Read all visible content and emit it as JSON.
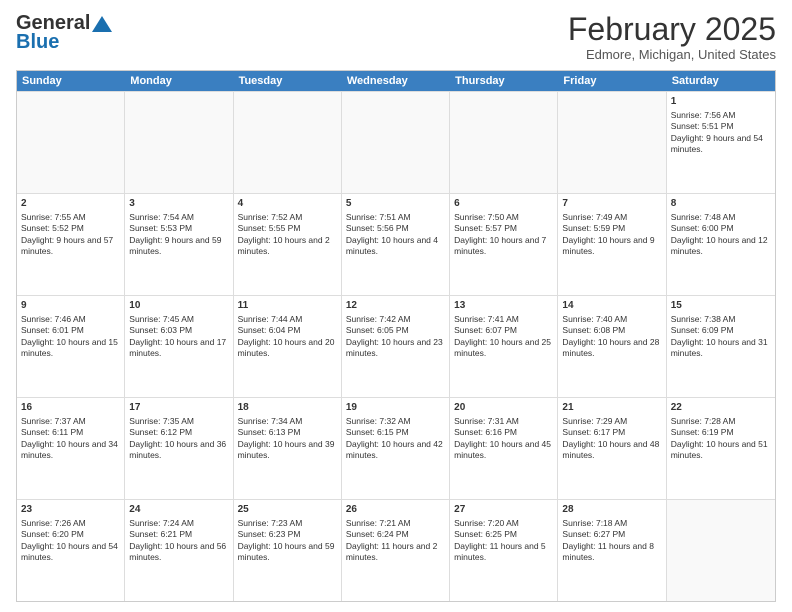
{
  "header": {
    "logo_general": "General",
    "logo_blue": "Blue",
    "month_title": "February 2025",
    "location": "Edmore, Michigan, United States"
  },
  "calendar": {
    "days_of_week": [
      "Sunday",
      "Monday",
      "Tuesday",
      "Wednesday",
      "Thursday",
      "Friday",
      "Saturday"
    ],
    "weeks": [
      [
        {
          "day": "",
          "empty": true
        },
        {
          "day": "",
          "empty": true
        },
        {
          "day": "",
          "empty": true
        },
        {
          "day": "",
          "empty": true
        },
        {
          "day": "",
          "empty": true
        },
        {
          "day": "",
          "empty": true
        },
        {
          "day": "1",
          "info": "Sunrise: 7:56 AM\nSunset: 5:51 PM\nDaylight: 9 hours and 54 minutes."
        }
      ],
      [
        {
          "day": "2",
          "info": "Sunrise: 7:55 AM\nSunset: 5:52 PM\nDaylight: 9 hours and 57 minutes."
        },
        {
          "day": "3",
          "info": "Sunrise: 7:54 AM\nSunset: 5:53 PM\nDaylight: 9 hours and 59 minutes."
        },
        {
          "day": "4",
          "info": "Sunrise: 7:52 AM\nSunset: 5:55 PM\nDaylight: 10 hours and 2 minutes."
        },
        {
          "day": "5",
          "info": "Sunrise: 7:51 AM\nSunset: 5:56 PM\nDaylight: 10 hours and 4 minutes."
        },
        {
          "day": "6",
          "info": "Sunrise: 7:50 AM\nSunset: 5:57 PM\nDaylight: 10 hours and 7 minutes."
        },
        {
          "day": "7",
          "info": "Sunrise: 7:49 AM\nSunset: 5:59 PM\nDaylight: 10 hours and 9 minutes."
        },
        {
          "day": "8",
          "info": "Sunrise: 7:48 AM\nSunset: 6:00 PM\nDaylight: 10 hours and 12 minutes."
        }
      ],
      [
        {
          "day": "9",
          "info": "Sunrise: 7:46 AM\nSunset: 6:01 PM\nDaylight: 10 hours and 15 minutes."
        },
        {
          "day": "10",
          "info": "Sunrise: 7:45 AM\nSunset: 6:03 PM\nDaylight: 10 hours and 17 minutes."
        },
        {
          "day": "11",
          "info": "Sunrise: 7:44 AM\nSunset: 6:04 PM\nDaylight: 10 hours and 20 minutes."
        },
        {
          "day": "12",
          "info": "Sunrise: 7:42 AM\nSunset: 6:05 PM\nDaylight: 10 hours and 23 minutes."
        },
        {
          "day": "13",
          "info": "Sunrise: 7:41 AM\nSunset: 6:07 PM\nDaylight: 10 hours and 25 minutes."
        },
        {
          "day": "14",
          "info": "Sunrise: 7:40 AM\nSunset: 6:08 PM\nDaylight: 10 hours and 28 minutes."
        },
        {
          "day": "15",
          "info": "Sunrise: 7:38 AM\nSunset: 6:09 PM\nDaylight: 10 hours and 31 minutes."
        }
      ],
      [
        {
          "day": "16",
          "info": "Sunrise: 7:37 AM\nSunset: 6:11 PM\nDaylight: 10 hours and 34 minutes."
        },
        {
          "day": "17",
          "info": "Sunrise: 7:35 AM\nSunset: 6:12 PM\nDaylight: 10 hours and 36 minutes."
        },
        {
          "day": "18",
          "info": "Sunrise: 7:34 AM\nSunset: 6:13 PM\nDaylight: 10 hours and 39 minutes."
        },
        {
          "day": "19",
          "info": "Sunrise: 7:32 AM\nSunset: 6:15 PM\nDaylight: 10 hours and 42 minutes."
        },
        {
          "day": "20",
          "info": "Sunrise: 7:31 AM\nSunset: 6:16 PM\nDaylight: 10 hours and 45 minutes."
        },
        {
          "day": "21",
          "info": "Sunrise: 7:29 AM\nSunset: 6:17 PM\nDaylight: 10 hours and 48 minutes."
        },
        {
          "day": "22",
          "info": "Sunrise: 7:28 AM\nSunset: 6:19 PM\nDaylight: 10 hours and 51 minutes."
        }
      ],
      [
        {
          "day": "23",
          "info": "Sunrise: 7:26 AM\nSunset: 6:20 PM\nDaylight: 10 hours and 54 minutes."
        },
        {
          "day": "24",
          "info": "Sunrise: 7:24 AM\nSunset: 6:21 PM\nDaylight: 10 hours and 56 minutes."
        },
        {
          "day": "25",
          "info": "Sunrise: 7:23 AM\nSunset: 6:23 PM\nDaylight: 10 hours and 59 minutes."
        },
        {
          "day": "26",
          "info": "Sunrise: 7:21 AM\nSunset: 6:24 PM\nDaylight: 11 hours and 2 minutes."
        },
        {
          "day": "27",
          "info": "Sunrise: 7:20 AM\nSunset: 6:25 PM\nDaylight: 11 hours and 5 minutes."
        },
        {
          "day": "28",
          "info": "Sunrise: 7:18 AM\nSunset: 6:27 PM\nDaylight: 11 hours and 8 minutes."
        },
        {
          "day": "",
          "empty": true
        }
      ]
    ]
  }
}
